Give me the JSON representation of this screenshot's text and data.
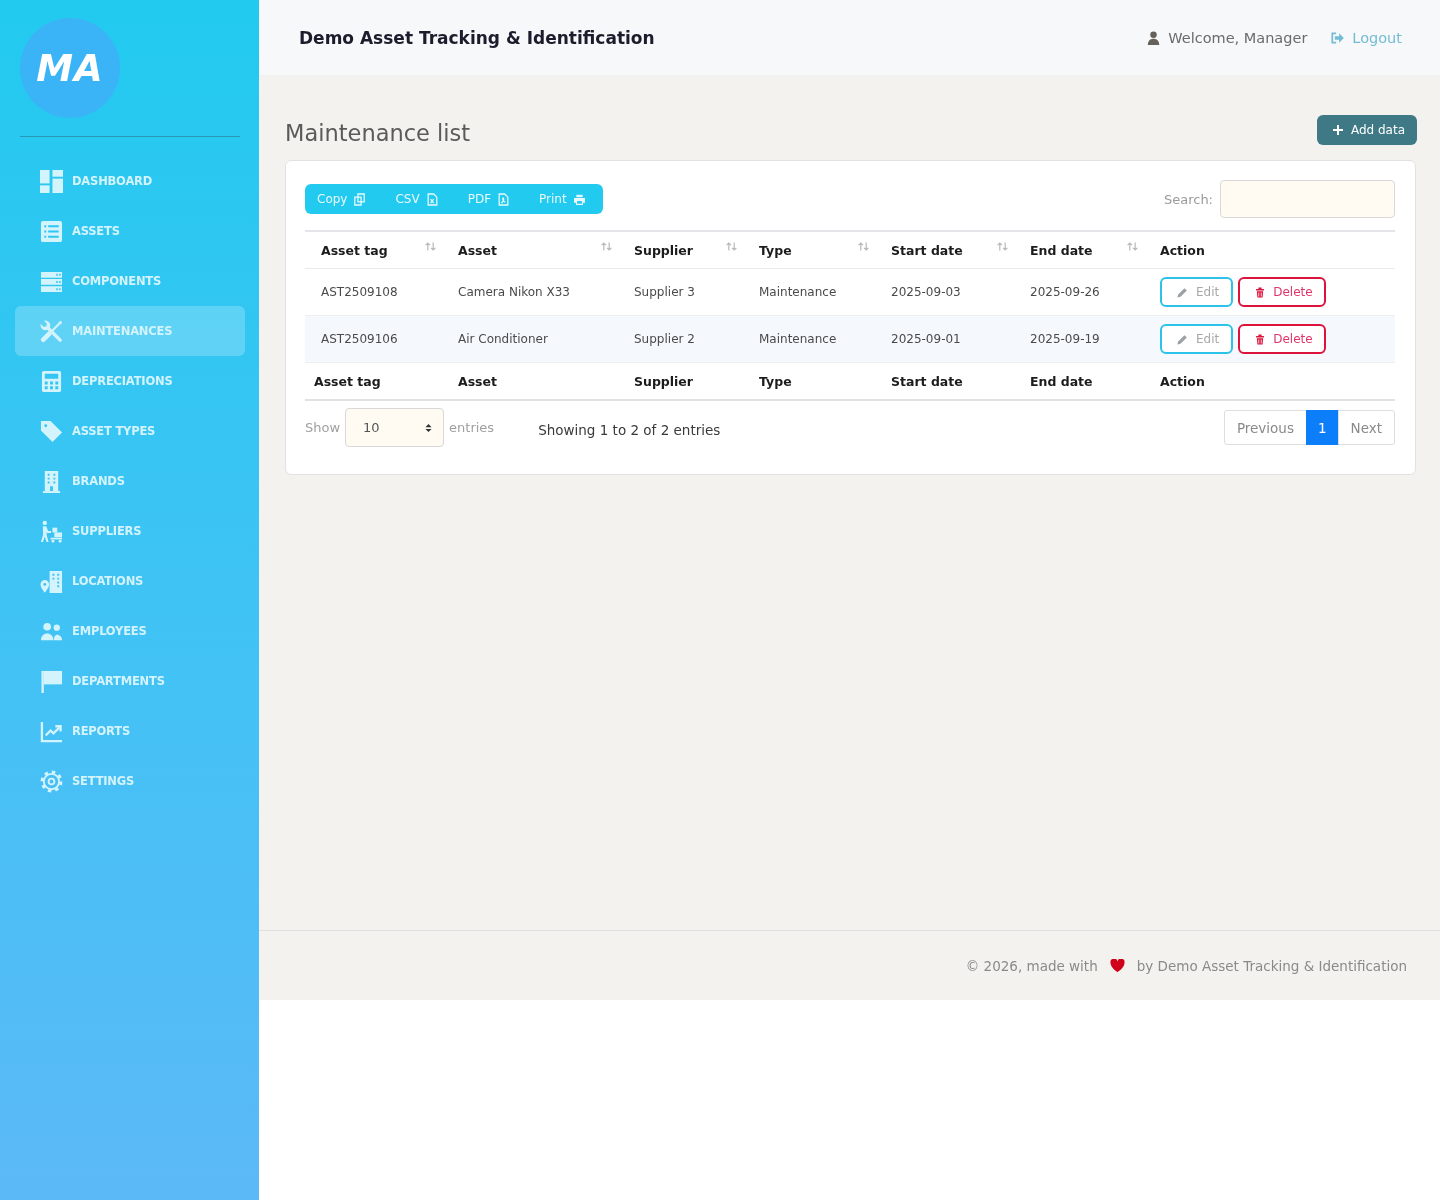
{
  "sidebar": {
    "logo": "MA",
    "items": [
      {
        "label": "DASHBOARD",
        "selected": false
      },
      {
        "label": "ASSETS",
        "selected": false
      },
      {
        "label": "COMPONENTS",
        "selected": false
      },
      {
        "label": "MAINTENANCES",
        "selected": true
      },
      {
        "label": "DEPRECIATIONS",
        "selected": false
      },
      {
        "label": "ASSET TYPES",
        "selected": false
      },
      {
        "label": "BRANDS",
        "selected": false
      },
      {
        "label": "SUPPLIERS",
        "selected": false
      },
      {
        "label": "LOCATIONS",
        "selected": false
      },
      {
        "label": "EMPLOYEES",
        "selected": false
      },
      {
        "label": "DEPARTMENTS",
        "selected": false
      },
      {
        "label": "REPORTS",
        "selected": false
      },
      {
        "label": "SETTINGS",
        "selected": false
      }
    ]
  },
  "header": {
    "title": "Demo Asset Tracking & Identification",
    "user": "Welcome, Manager",
    "logout": "Logout"
  },
  "page": {
    "title": "Maintenance list",
    "add_button": "Add data"
  },
  "export_buttons": [
    {
      "label": "Copy"
    },
    {
      "label": "CSV"
    },
    {
      "label": "PDF"
    },
    {
      "label": "Print"
    }
  ],
  "search": {
    "label": "Search:"
  },
  "table": {
    "columns": [
      {
        "label": "Asset tag",
        "sortable": true
      },
      {
        "label": "Asset",
        "sortable": true
      },
      {
        "label": "Supplier",
        "sortable": true
      },
      {
        "label": "Type",
        "sortable": true
      },
      {
        "label": "Start date",
        "sortable": true
      },
      {
        "label": "End date",
        "sortable": true
      },
      {
        "label": "Action",
        "sortable": false
      }
    ],
    "rows": [
      {
        "cells": [
          "AST2509108",
          "Camera Nikon X33",
          "Supplier 3",
          "Maintenance",
          "2025-09-03",
          "2025-09-26"
        ],
        "actions": [
          {
            "kind": "edit",
            "label": "Edit"
          },
          {
            "kind": "delete",
            "label": "Delete"
          }
        ]
      },
      {
        "cells": [
          "AST2509106",
          "Air Conditioner",
          "Supplier 2",
          "Maintenance",
          "2025-09-01",
          "2025-09-19"
        ],
        "actions": [
          {
            "kind": "edit",
            "label": "Edit"
          },
          {
            "kind": "delete",
            "label": "Delete"
          }
        ]
      }
    ],
    "footer": [
      "Asset tag",
      "Asset",
      "Supplier",
      "Type",
      "Start date",
      "End date",
      "Action"
    ]
  },
  "length_menu": {
    "label_before": "Show",
    "value": "10",
    "label_after": "entries"
  },
  "info": "Showing 1 to 2 of 2 entries",
  "pagination": [
    {
      "label": "Previous",
      "selected": false
    },
    {
      "label": "1",
      "selected": true
    },
    {
      "label": "Next",
      "selected": false
    }
  ],
  "footer": {
    "text_before": "© 2026, made with",
    "text_after": "by Demo Asset Tracking & Identification"
  }
}
